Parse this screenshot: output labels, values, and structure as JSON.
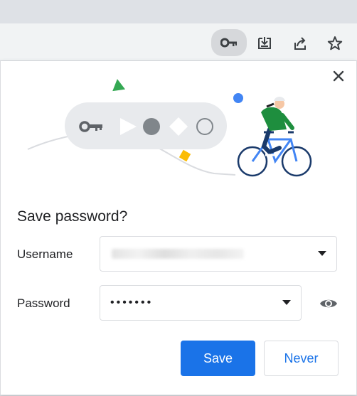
{
  "browser": {
    "toolbar_icons": [
      "key-icon",
      "install-icon",
      "share-icon",
      "bookmark-star-icon"
    ]
  },
  "dialog": {
    "title": "Save password?",
    "username": {
      "label": "Username",
      "value": ""
    },
    "password": {
      "label": "Password",
      "value": "•••••••"
    },
    "save_label": "Save",
    "never_label": "Never"
  },
  "colors": {
    "primary": "#1a73e8",
    "illustration_green": "#34a853",
    "illustration_blue": "#4285f4",
    "illustration_yellow": "#fbbc04"
  }
}
